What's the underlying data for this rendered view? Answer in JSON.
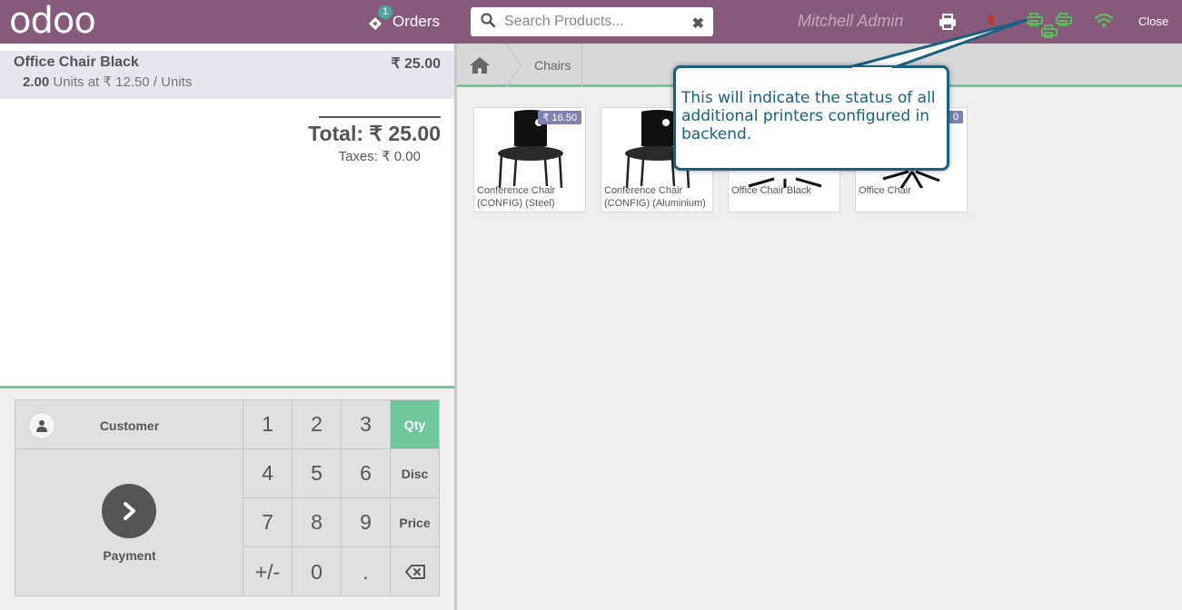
{
  "header": {
    "logo": "odoo",
    "orders_badge": "1",
    "orders_label": "Orders",
    "search_placeholder": "Search Products...",
    "username": "Mitchell Admin",
    "close_label": "Close"
  },
  "order": {
    "lines": [
      {
        "name": "Office Chair Black",
        "price": "₹ 25.00",
        "qty": "2.00",
        "info": " Units at ₹ 12.50 / Units"
      }
    ],
    "total": "Total: ₹ 25.00",
    "taxes": "Taxes: ₹ 0.00"
  },
  "controls": {
    "customer_label": "Customer",
    "payment_label": "Payment",
    "keys": [
      "1",
      "2",
      "3",
      "Qty",
      "4",
      "5",
      "6",
      "Disc",
      "7",
      "8",
      "9",
      "Price",
      "+/-",
      "0",
      "."
    ],
    "active_mode": "Qty"
  },
  "breadcrumb": {
    "category": "Chairs"
  },
  "products": [
    {
      "name": "Conference Chair (CONFIG) (Steel)",
      "price": "₹ 16.50"
    },
    {
      "name": "Conference Chair (CONFIG) (Aluminium)",
      "price": ""
    },
    {
      "name": "Office Chair Black",
      "price": ""
    },
    {
      "name": "Office Chair",
      "price": "0"
    }
  ],
  "tooltip": {
    "text": "This will indicate the status of all additional printers configured in backend."
  },
  "colors": {
    "header": "#875a7b",
    "accent_green": "#6ec89b",
    "tooltip_border": "#1c6080",
    "printer_green": "#5cb85c",
    "price_tag": "#7f82ac"
  }
}
